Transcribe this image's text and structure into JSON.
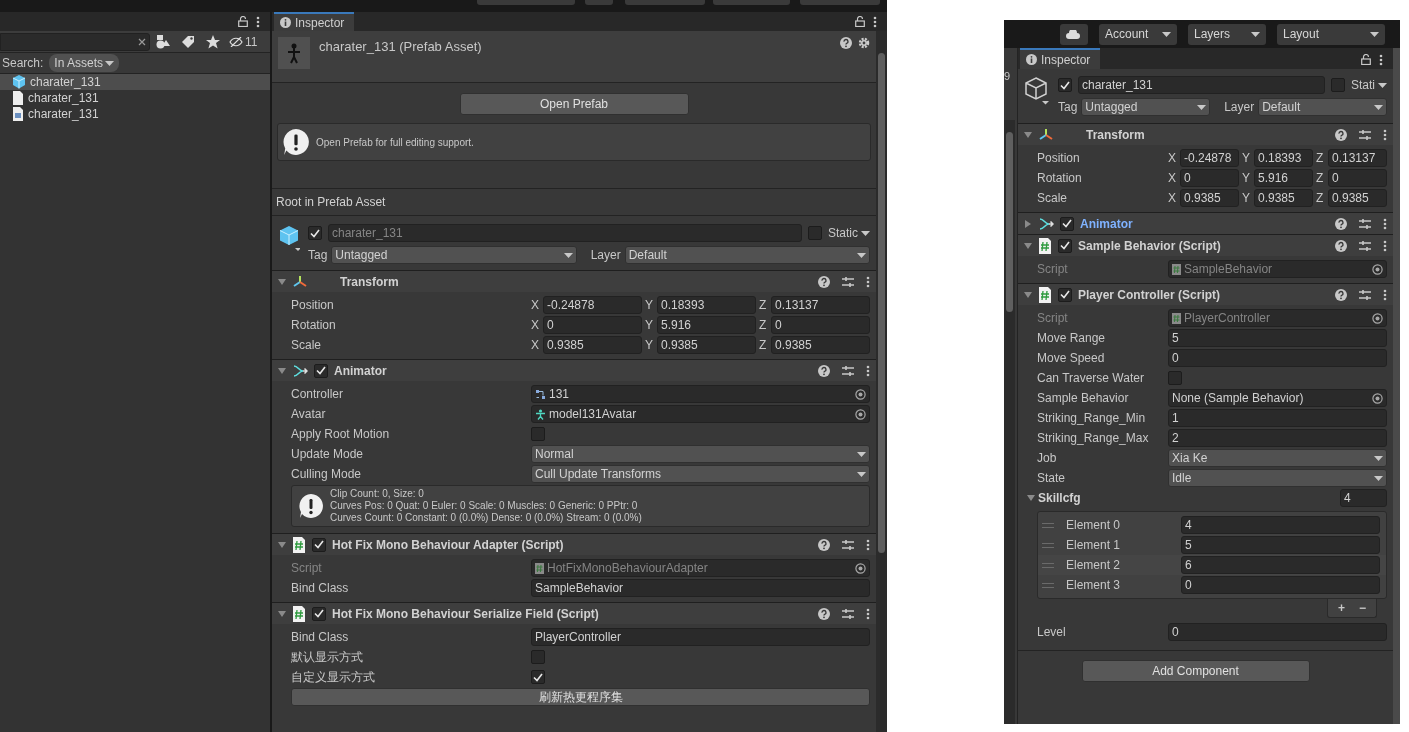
{
  "left_editor": {
    "project": {
      "hidden_count": "11",
      "search_scope_label": "Search:",
      "search_scope": "In Assets",
      "items": [
        {
          "name": "charater_131",
          "kind": "prefab",
          "selected": true
        },
        {
          "name": "charater_131",
          "kind": "document",
          "selected": false
        },
        {
          "name": "charater_131",
          "kind": "asset",
          "selected": false
        }
      ]
    },
    "inspector": {
      "tab": "Inspector",
      "prefab_header": {
        "title": "charater_131 (Prefab Asset)",
        "open_button": "Open Prefab",
        "help_text": "Open Prefab for full editing support."
      },
      "section_title": "Root in Prefab Asset",
      "game_object": {
        "kind": "prefab",
        "active": true,
        "name": "charater_131",
        "name_disabled": true,
        "static": false,
        "static_label": "Static",
        "tag_label": "Tag",
        "tag": "Untagged",
        "layer_label": "Layer",
        "layer": "Default"
      },
      "components": [
        {
          "title": "Transform",
          "kind": "transform",
          "expanded": true,
          "overridden": false,
          "fields": [
            {
              "kind": "vector3",
              "label": "Position",
              "values": [
                {
                  "axis": "X",
                  "value": "-0.24878"
                },
                {
                  "axis": "Y",
                  "value": "0.18393"
                },
                {
                  "axis": "Z",
                  "value": "0.13137"
                }
              ]
            },
            {
              "kind": "vector3",
              "label": "Rotation",
              "values": [
                {
                  "axis": "X",
                  "value": "0"
                },
                {
                  "axis": "Y",
                  "value": "5.916"
                },
                {
                  "axis": "Z",
                  "value": "0"
                }
              ]
            },
            {
              "kind": "vector3",
              "label": "Scale",
              "values": [
                {
                  "axis": "X",
                  "value": "0.9385"
                },
                {
                  "axis": "Y",
                  "value": "0.9385"
                },
                {
                  "axis": "Z",
                  "value": "0.9385"
                }
              ]
            }
          ]
        },
        {
          "title": "Animator",
          "kind": "animator",
          "enabled": true,
          "expanded": true,
          "overridden": false,
          "fields": [
            {
              "kind": "controller",
              "label": "Controller",
              "value": "131",
              "disabled": false
            },
            {
              "kind": "avatar",
              "label": "Avatar",
              "value": "model131Avatar",
              "disabled": false
            },
            {
              "kind": "checkbox",
              "label": "Apply Root Motion",
              "checked": false
            },
            {
              "kind": "dropdown",
              "label": "Update Mode",
              "value": "Normal"
            },
            {
              "kind": "dropdown",
              "label": "Culling Mode",
              "value": "Cull Update Transforms"
            },
            {
              "kind": "info",
              "lines": [
                "Clip Count: 0, Size: 0",
                "Curves Pos: 0 Quat: 0 Euler: 0 Scale: 0 Muscles: 0 Generic: 0 PPtr: 0",
                "Curves Count: 0 Constant: 0 (0.0%) Dense: 0 (0.0%) Stream: 0 (0.0%)"
              ]
            }
          ]
        },
        {
          "title": "Hot Fix Mono Behaviour Adapter (Script)",
          "kind": "script",
          "enabled": true,
          "expanded": true,
          "overridden": false,
          "fields": [
            {
              "kind": "script",
              "label": "Script",
              "value": "HotFixMonoBehaviourAdapter",
              "disabled": true
            },
            {
              "kind": "text",
              "label": "Bind Class",
              "value": "SampleBehavior"
            }
          ]
        },
        {
          "title": "Hot Fix Mono Behaviour Serialize Field (Script)",
          "kind": "script",
          "enabled": true,
          "expanded": true,
          "overridden": false,
          "fields": [
            {
              "kind": "text",
              "label": "Bind Class",
              "value": "PlayerController"
            },
            {
              "kind": "checkbox",
              "label": "默认显示方式",
              "checked": false
            },
            {
              "kind": "checkbox",
              "label": "自定义显示方式",
              "checked": true
            },
            {
              "kind": "button",
              "label": "刷新热更程序集"
            }
          ]
        }
      ]
    }
  },
  "right_editor": {
    "toolbar": [
      "Account",
      "Layers",
      "Layout"
    ],
    "side_fragment": "9",
    "inspector": {
      "tab": "Inspector",
      "game_object": {
        "kind": "scene",
        "active": true,
        "name": "charater_131",
        "name_disabled": false,
        "static": false,
        "static_label": "Stati",
        "tag_label": "Tag",
        "tag": "Untagged",
        "layer_label": "Layer",
        "layer": "Default"
      },
      "components": [
        {
          "title": "Transform",
          "kind": "transform",
          "expanded": true,
          "overridden": false,
          "fields": [
            {
              "kind": "vector3",
              "label": "Position",
              "values": [
                {
                  "axis": "X",
                  "value": "-0.24878"
                },
                {
                  "axis": "Y",
                  "value": "0.18393"
                },
                {
                  "axis": "Z",
                  "value": "0.13137"
                }
              ]
            },
            {
              "kind": "vector3",
              "label": "Rotation",
              "values": [
                {
                  "axis": "X",
                  "value": "0"
                },
                {
                  "axis": "Y",
                  "value": "5.916"
                },
                {
                  "axis": "Z",
                  "value": "0"
                }
              ]
            },
            {
              "kind": "vector3",
              "label": "Scale",
              "values": [
                {
                  "axis": "X",
                  "value": "0.9385"
                },
                {
                  "axis": "Y",
                  "value": "0.9385"
                },
                {
                  "axis": "Z",
                  "value": "0.9385"
                }
              ]
            }
          ]
        },
        {
          "title": "Animator",
          "kind": "animator",
          "enabled": true,
          "expanded": false,
          "overridden": true
        },
        {
          "title": "Sample Behavior (Script)",
          "kind": "script",
          "enabled": true,
          "expanded": true,
          "overridden": false,
          "fields": [
            {
              "kind": "script",
              "label": "Script",
              "value": "SampleBehavior",
              "disabled": true
            }
          ]
        },
        {
          "title": "Player Controller (Script)",
          "kind": "script",
          "enabled": true,
          "expanded": true,
          "overridden": false,
          "fields": [
            {
              "kind": "script",
              "label": "Script",
              "value": "PlayerController",
              "disabled": true
            },
            {
              "kind": "text",
              "label": "Move Range",
              "value": "5"
            },
            {
              "kind": "text",
              "label": "Move Speed",
              "value": "0"
            },
            {
              "kind": "checkbox",
              "label": "Can Traverse Water",
              "checked": false
            },
            {
              "kind": "object",
              "label": "Sample Behavior",
              "value": "None (Sample Behavior)",
              "disabled": false
            },
            {
              "kind": "text",
              "label": "Striking_Range_Min",
              "value": "1"
            },
            {
              "kind": "text",
              "label": "Striking_Range_Max",
              "value": "2"
            },
            {
              "kind": "dropdown",
              "label": "Job",
              "value": "Xia Ke"
            },
            {
              "kind": "dropdown",
              "label": "State",
              "value": "Idle"
            },
            {
              "kind": "list",
              "label": "Skillcfg",
              "expanded": true,
              "size": "4",
              "add": "+",
              "remove": "−",
              "elements": [
                {
                  "label": "Element 0",
                  "value": "4",
                  "selected": false
                },
                {
                  "label": "Element 1",
                  "value": "5",
                  "selected": false
                },
                {
                  "label": "Element 2",
                  "value": "6",
                  "selected": true
                },
                {
                  "label": "Element 3",
                  "value": "0",
                  "selected": false
                }
              ]
            },
            {
              "kind": "text",
              "label": "Level",
              "value": "0"
            }
          ]
        }
      ],
      "add_button": "Add Component"
    }
  }
}
